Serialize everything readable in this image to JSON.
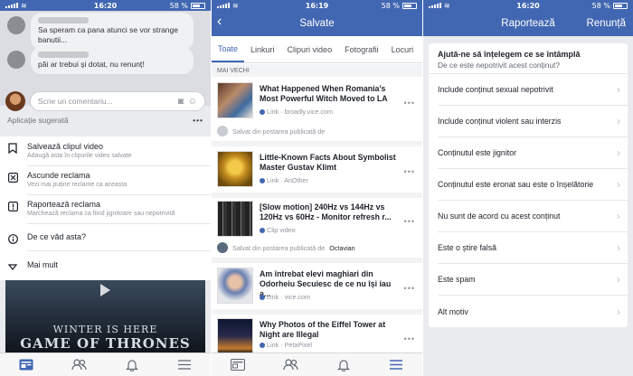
{
  "left_screen": {
    "status": {
      "carrier": "",
      "time": "16:20",
      "battery": "58 %"
    },
    "comments": [
      "Sa speram ca pana atunci se vor strange banutii...",
      "păi ar trebui și dotat, nu renunț!"
    ],
    "composer_placeholder": "Scrie un comentariu...",
    "suggested_label": "Aplicație sugerată",
    "menu": [
      {
        "title": "Salvează clipul video",
        "subtitle": "Adaugă asta în clipurile video salvate",
        "icon": "bookmark-icon"
      },
      {
        "title": "Ascunde reclama",
        "subtitle": "Vezi mai puține reclame ca aceasta",
        "icon": "close-box-icon"
      },
      {
        "title": "Raportează reclama",
        "subtitle": "Marchează reclama ca fiind jignitoare sau nepotrivită",
        "icon": "alert-box-icon"
      },
      {
        "title": "De ce văd asta?",
        "subtitle": "",
        "icon": "info-icon"
      },
      {
        "title": "Mai mult",
        "subtitle": "",
        "icon": "more-icon"
      }
    ],
    "video": {
      "line1": "WINTER IS HERE",
      "line2": "GAME OF THRONES"
    }
  },
  "middle_screen": {
    "status": {
      "time": "16:19",
      "battery": "58 %"
    },
    "title": "Salvate",
    "tabs": [
      "Toate",
      "Linkuri",
      "Clipuri video",
      "Fotografii",
      "Locuri"
    ],
    "section_label": "MAI VECHI",
    "items": [
      {
        "title": "What Happened When Romania's Most Powerful Witch Moved to LA",
        "meta": "Link · broadly.vice.com"
      },
      {
        "title": "Little-Known Facts About Symbolist Master Gustav Klimt",
        "meta": "Link · AnOther"
      },
      {
        "title": "[Slow motion] 240Hz vs 144Hz vs 120Hz vs 60Hz - Monitor refresh r...",
        "meta": "Clip video"
      },
      {
        "title": "Am întrebat elevi maghiari din Odorheiu Secuiesc de ce nu își iau a...",
        "meta": "Link · vice.com"
      },
      {
        "title": "Why Photos of the Eiffel Tower at Night are Illegal",
        "meta": "Link · PetaPixel"
      }
    ],
    "saved_from_1": "Salvat din postarea publicată de",
    "saved_from_2": "Salvat din postarea publicată de",
    "saved_from_2_author": "Octavian"
  },
  "right_screen": {
    "status": {
      "time": "16:20",
      "battery": "58 %"
    },
    "title": "Raportează",
    "cancel_label": "Renunță",
    "heading": "Ajută-ne să înțelegem ce se întâmplă",
    "subheading": "De ce este nepotrivit acest conținut?",
    "options": [
      "Include conținut sexual nepotrivit",
      "Include conținut violent sau interzis",
      "Conținutul este jignitor",
      "Conținutul este eronat sau este o înșelătorie",
      "Nu sunt de acord cu acest conținut",
      "Este o știre falsă",
      "Este spam",
      "Alt motiv"
    ]
  },
  "colors": {
    "brand": "#4267b2",
    "background": "#e9ebee"
  }
}
